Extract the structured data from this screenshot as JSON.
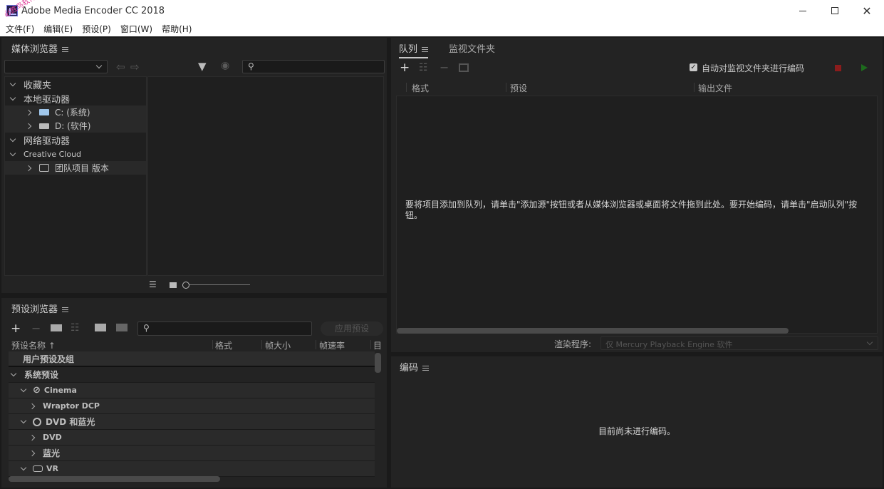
{
  "window": {
    "title": "Adobe Media Encoder CC 2018",
    "watermark": "必胜鸟软件站"
  },
  "menu": [
    "文件(F)",
    "编辑(E)",
    "预设(P)",
    "窗口(W)",
    "帮助(H)"
  ],
  "media_browser": {
    "title": "媒体浏览器",
    "tree": {
      "favorites": "收藏夹",
      "local_drives": "本地驱动器",
      "drive_c": "C: (系统)",
      "drive_d": "D: (软件)",
      "network_drives": "网络驱动器",
      "creative_cloud": "Creative Cloud",
      "team_projects": "团队项目 版本"
    }
  },
  "preset_browser": {
    "title": "预设浏览器",
    "apply_button": "应用预设",
    "columns": [
      "预设名称 ↑",
      "格式",
      "帧大小",
      "帧速率",
      "目"
    ],
    "rows": {
      "user_presets": "用户预设及组",
      "system_presets": "系统预设",
      "cinema": "Cinema",
      "wraptor": "Wraptor DCP",
      "dvd_bluray": "DVD 和蓝光",
      "dvd": "DVD",
      "bluray": "蓝光",
      "vr": "VR"
    }
  },
  "queue": {
    "tab_queue": "队列",
    "tab_watch": "监视文件夹",
    "auto_encode_label": "自动对监视文件夹进行编码",
    "columns": [
      "格式",
      "预设",
      "输出文件"
    ],
    "empty_message": "要将项目添加到队列，请单击\"添加源\"按钮或者从媒体浏览器或桌面将文件拖到此处。要开始编码，请单击\"启动队列\"按钮。",
    "renderer_label": "渲染程序:",
    "renderer_value": "仅 Mercury Playback Engine 软件"
  },
  "encoding": {
    "title": "编码",
    "empty_message": "目前尚未进行编码。"
  },
  "colors": {
    "accent": "#2d8ceb",
    "stop": "#8b1c1c",
    "start": "#1d6b1d"
  }
}
